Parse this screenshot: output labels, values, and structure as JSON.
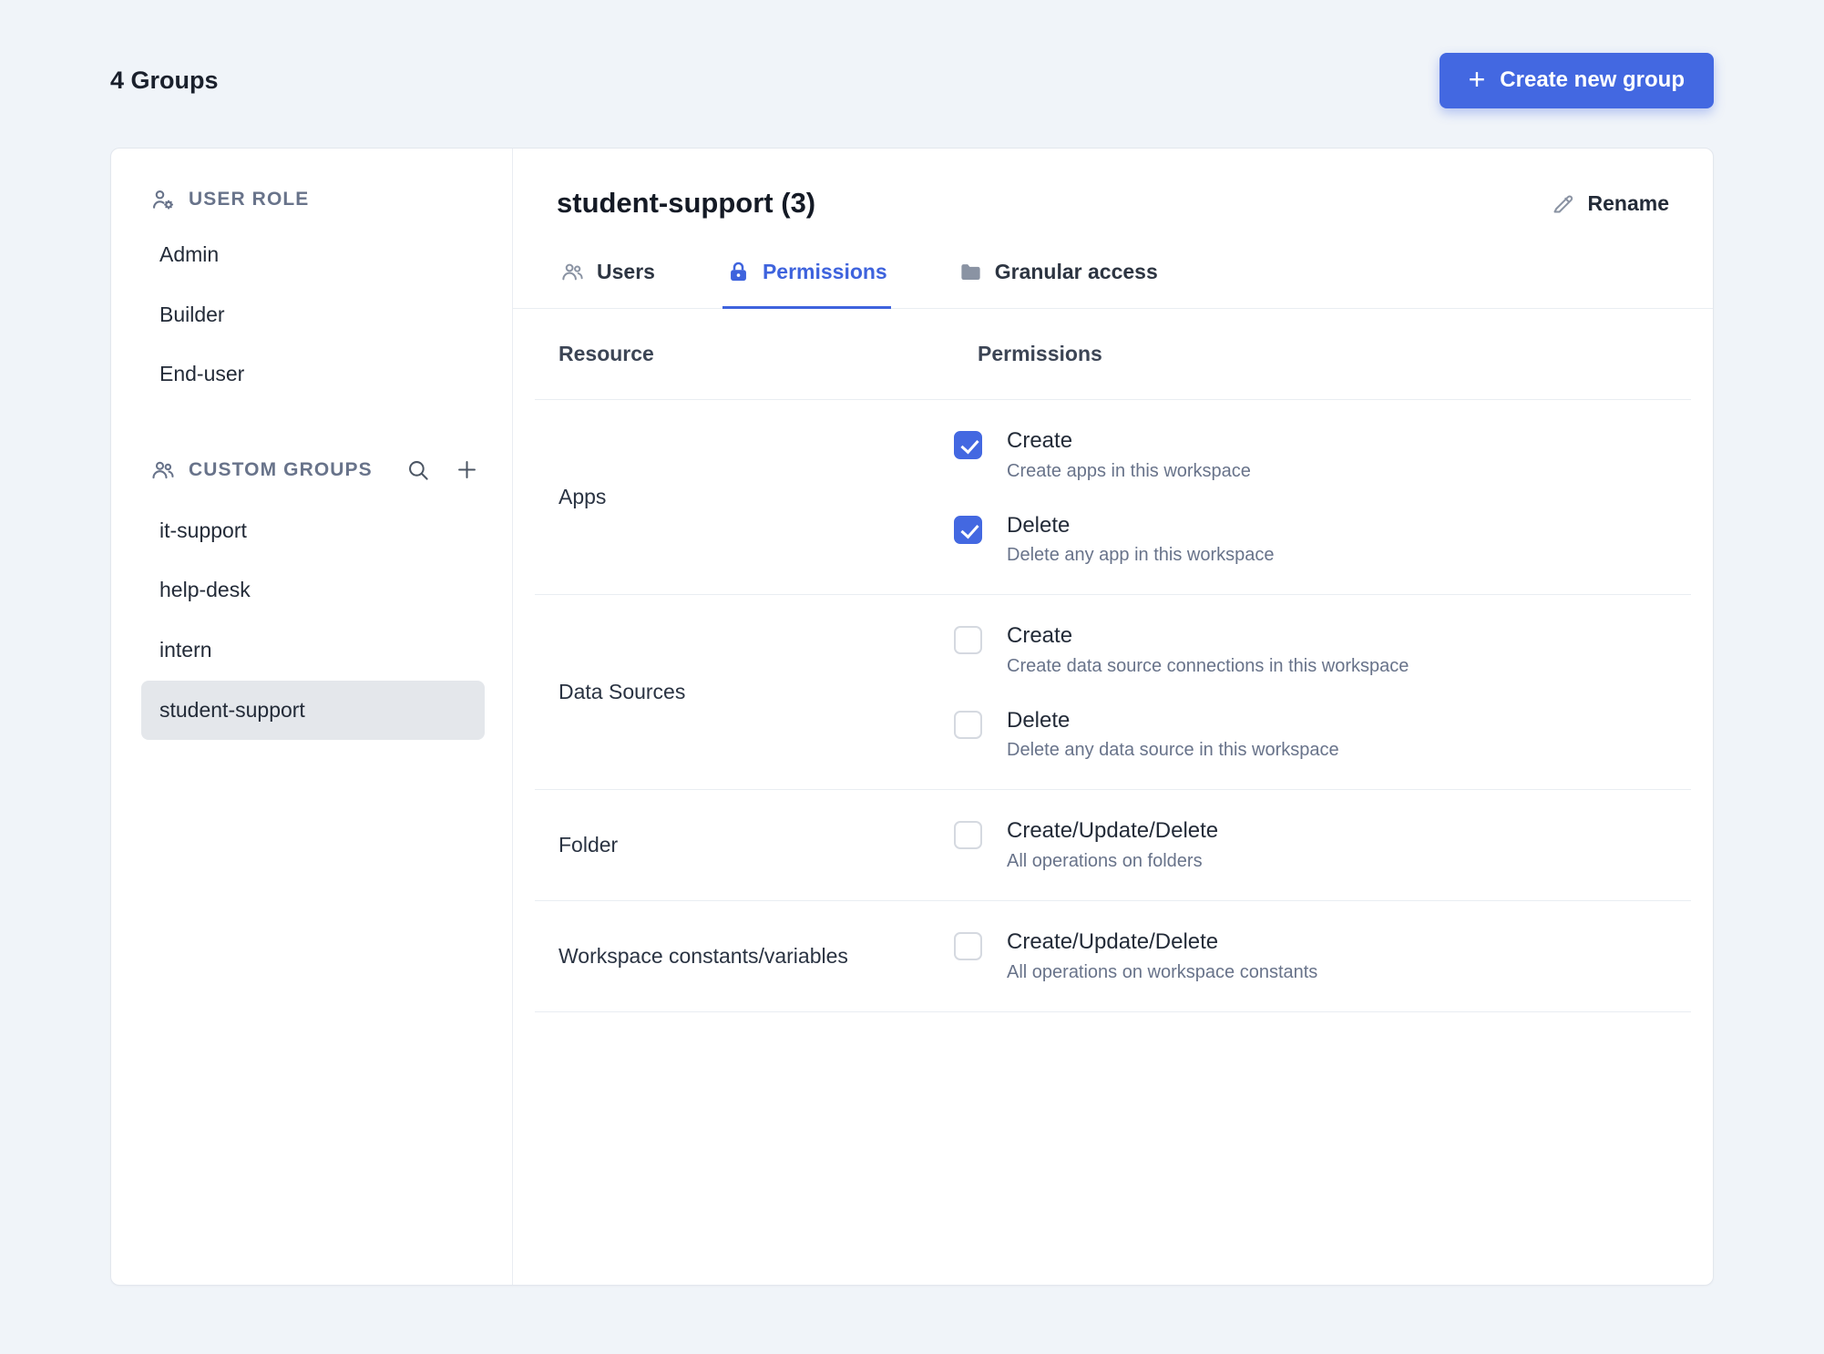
{
  "header": {
    "groups_count": "4 Groups",
    "create_group_button": "Create new group"
  },
  "sidebar": {
    "user_role": {
      "header": "USER ROLE",
      "items": [
        {
          "label": "Admin",
          "selected": false
        },
        {
          "label": "Builder",
          "selected": false
        },
        {
          "label": "End-user",
          "selected": false
        }
      ]
    },
    "custom_groups": {
      "header": "CUSTOM GROUPS",
      "items": [
        {
          "label": "it-support",
          "selected": false
        },
        {
          "label": "help-desk",
          "selected": false
        },
        {
          "label": "intern",
          "selected": false
        },
        {
          "label": "student-support",
          "selected": true
        }
      ]
    }
  },
  "panel": {
    "title": "student-support (3)",
    "rename_label": "Rename",
    "tabs": [
      {
        "label": "Users",
        "active": false
      },
      {
        "label": "Permissions",
        "active": true
      },
      {
        "label": "Granular access",
        "active": false
      }
    ],
    "table": {
      "columns": [
        "Resource",
        "Permissions"
      ],
      "rows": [
        {
          "resource": "Apps",
          "permissions": [
            {
              "label": "Create",
              "description": "Create apps in this workspace",
              "checked": true
            },
            {
              "label": "Delete",
              "description": "Delete any app in this workspace",
              "checked": true
            }
          ]
        },
        {
          "resource": "Data Sources",
          "permissions": [
            {
              "label": "Create",
              "description": "Create data source connections in this workspace",
              "checked": false
            },
            {
              "label": "Delete",
              "description": "Delete any data source in this workspace",
              "checked": false
            }
          ]
        },
        {
          "resource": "Folder",
          "permissions": [
            {
              "label": "Create/Update/Delete",
              "description": "All operations on folders",
              "checked": false
            }
          ]
        },
        {
          "resource": "Workspace constants/variables",
          "permissions": [
            {
              "label": "Create/Update/Delete",
              "description": "All operations on workspace constants",
              "checked": false
            }
          ]
        }
      ]
    }
  },
  "icons": {
    "user_role": "user-gear-icon",
    "custom_groups": "users-icon",
    "search": "search-icon",
    "add_group": "plus-icon",
    "users_tab": "users-icon",
    "permissions_tab": "lock-icon",
    "granular_tab": "folder-icon",
    "rename": "pencil-icon"
  },
  "colors": {
    "accent": "#4368E1",
    "active_tab": "#3E63DD",
    "background": "#F0F4F9",
    "selected_item_bg": "#E4E7EB"
  }
}
